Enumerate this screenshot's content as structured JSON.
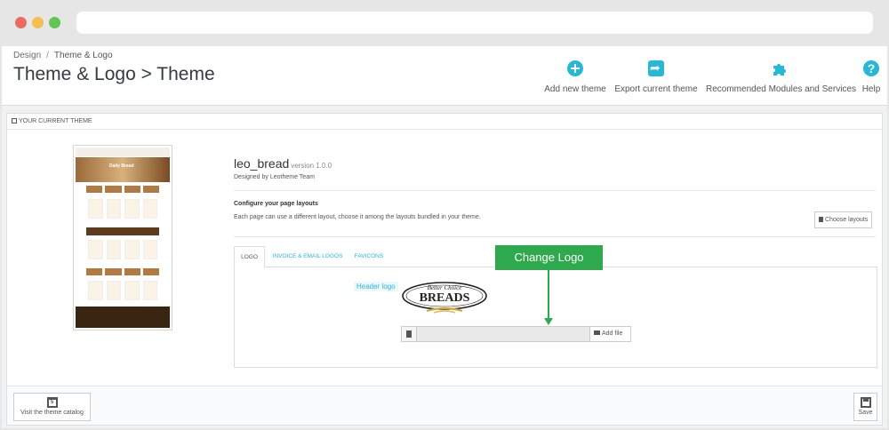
{
  "breadcrumb": {
    "parent": "Design",
    "separator": "/",
    "current": "Theme & Logo"
  },
  "page_title": "Theme & Logo > Theme",
  "toolbar": [
    {
      "label": "Add new theme",
      "icon": "plus-circle-icon"
    },
    {
      "label": "Export current theme",
      "icon": "share-icon"
    },
    {
      "label": "Recommended Modules and Services",
      "icon": "puzzle-icon"
    },
    {
      "label": "Help",
      "icon": "help-icon"
    }
  ],
  "panel": {
    "heading": "YOUR CURRENT THEME"
  },
  "theme": {
    "name": "leo_bread",
    "version": "version 1.0.0",
    "author": "Designed by Leotheme Team",
    "preview_text": "Daily Bread"
  },
  "layouts": {
    "title": "Configure your page layouts",
    "description": "Each page can use a different layout, choose it among the layouts bundled in your theme.",
    "button": "Choose layouts"
  },
  "tabs": [
    {
      "label": "LOGO",
      "active": true
    },
    {
      "label": "INVOICE & EMAIL LOGOS",
      "active": false
    },
    {
      "label": "FAVICONS",
      "active": false
    }
  ],
  "logo_section": {
    "label": "Header logo",
    "logo_text_top": "Better Choice",
    "logo_text_main": "BREADS",
    "add_file": "Add file"
  },
  "footer": {
    "catalog_button": "Visit the theme catalog",
    "save_button": "Save"
  },
  "callout": {
    "text": "Change Logo"
  },
  "colors": {
    "accent": "#25b9d7",
    "callout": "#2fa94d"
  }
}
